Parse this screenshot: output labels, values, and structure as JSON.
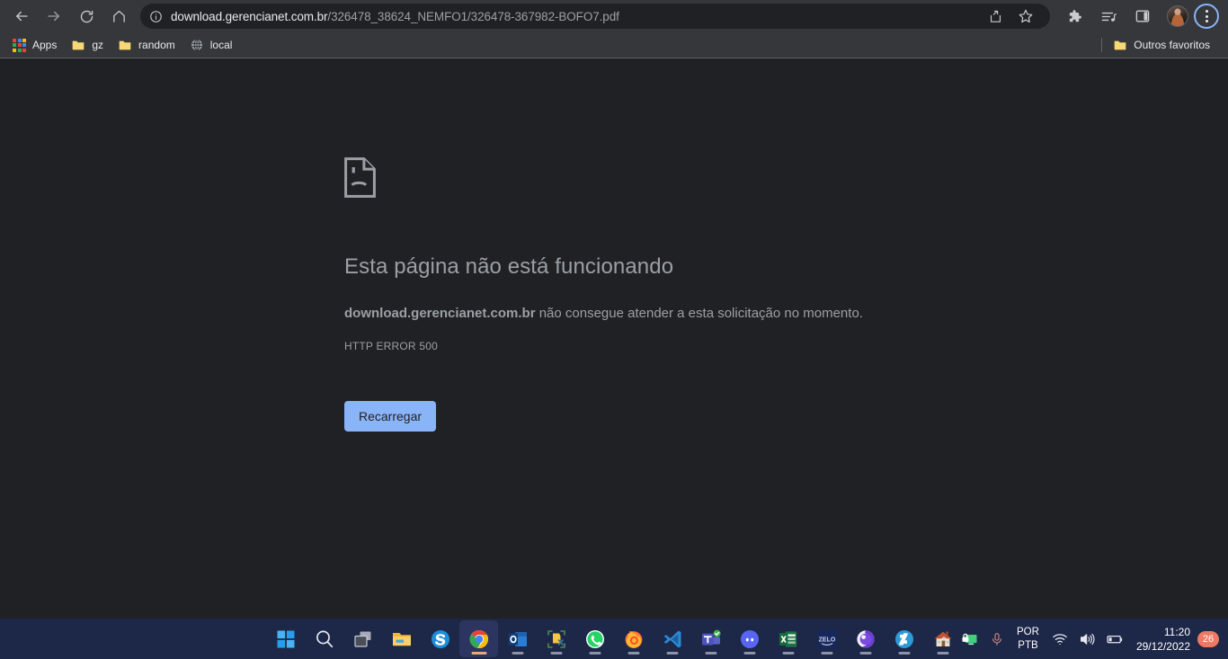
{
  "browser": {
    "nav": {
      "back": "Voltar",
      "forward": "Avançar",
      "reload": "Atualizar",
      "home": "Página inicial"
    },
    "omnibox": {
      "site_info_icon": "info-circle-icon",
      "url_host": "download.gerencianet.com.br",
      "url_path": "/326478_38624_NEMFO1/326478-367982-BOFO7.pdf",
      "share_icon": "share-icon",
      "bookmark_icon": "star-icon"
    },
    "toolbar_right": {
      "extensions_icon": "puzzle-piece-icon",
      "media_icon": "media-playlist-icon",
      "side_panel_icon": "side-panel-icon",
      "avatar_label": "Perfil",
      "menu_label": "Personalizar e controlar o Google Chrome"
    },
    "bookmarks": {
      "items": [
        {
          "label": "Apps",
          "icon": "apps-grid-icon"
        },
        {
          "label": "gz",
          "icon": "folder-icon"
        },
        {
          "label": "random",
          "icon": "folder-icon"
        },
        {
          "label": "local",
          "icon": "globe-icon"
        }
      ],
      "other": {
        "label": "Outros favoritos",
        "icon": "folder-icon"
      }
    }
  },
  "error_page": {
    "icon": "sad-document-icon",
    "title": "Esta página não está funcionando",
    "host": "download.gerencianet.com.br",
    "description_rest": " não consegue atender a esta solicitação no momento.",
    "error_code": "HTTP ERROR 500",
    "reload_button": "Recarregar",
    "button_color": "#8ab4f8",
    "background_color": "#202124",
    "text_color": "#9aa0a6"
  },
  "taskbar": {
    "background_color": "#1d2748",
    "apps": [
      {
        "name": "start-button",
        "icon": "windows-logo-icon",
        "active": false,
        "running": false
      },
      {
        "name": "search-button",
        "icon": "search-icon",
        "active": false,
        "running": false
      },
      {
        "name": "task-view-button",
        "icon": "task-view-icon",
        "active": false,
        "running": false
      },
      {
        "name": "file-explorer",
        "icon": "folder-icon",
        "active": false,
        "running": false
      },
      {
        "name": "skype",
        "icon": "skype-icon",
        "active": false,
        "running": false
      },
      {
        "name": "google-chrome",
        "icon": "chrome-icon",
        "active": true,
        "running": true
      },
      {
        "name": "outlook",
        "icon": "outlook-icon",
        "active": false,
        "running": true
      },
      {
        "name": "snipping-tool",
        "icon": "snipping-tool-icon",
        "active": false,
        "running": true
      },
      {
        "name": "whatsapp",
        "icon": "whatsapp-icon",
        "active": false,
        "running": true
      },
      {
        "name": "firefox",
        "icon": "firefox-icon",
        "active": false,
        "running": true
      },
      {
        "name": "visual-studio-code",
        "icon": "vscode-icon",
        "active": false,
        "running": true
      },
      {
        "name": "microsoft-teams",
        "icon": "teams-icon",
        "active": false,
        "running": true
      },
      {
        "name": "discord",
        "icon": "discord-icon",
        "active": false,
        "running": true
      },
      {
        "name": "excel",
        "icon": "excel-icon",
        "active": false,
        "running": true
      },
      {
        "name": "zello",
        "icon": "zello-icon",
        "active": false,
        "running": true
      },
      {
        "name": "purple-app",
        "icon": "purple-circle-icon",
        "active": false,
        "running": true
      },
      {
        "name": "deviantart",
        "icon": "deviantart-icon",
        "active": false,
        "running": true
      },
      {
        "name": "home-app",
        "icon": "house-icon",
        "active": false,
        "running": true
      }
    ],
    "tray": {
      "overflow_icon": "chevron-up-icon",
      "monitor_icon": "monitor-lock-icon",
      "mic_icon": "microphone-icon",
      "language_line1": "POR",
      "language_line2": "PTB",
      "wifi_icon": "wifi-icon",
      "volume_icon": "speaker-icon",
      "battery_icon": "battery-icon",
      "time": "11:20",
      "date": "29/12/2022",
      "notification_count": "26",
      "notification_color": "#ed7b63"
    }
  }
}
